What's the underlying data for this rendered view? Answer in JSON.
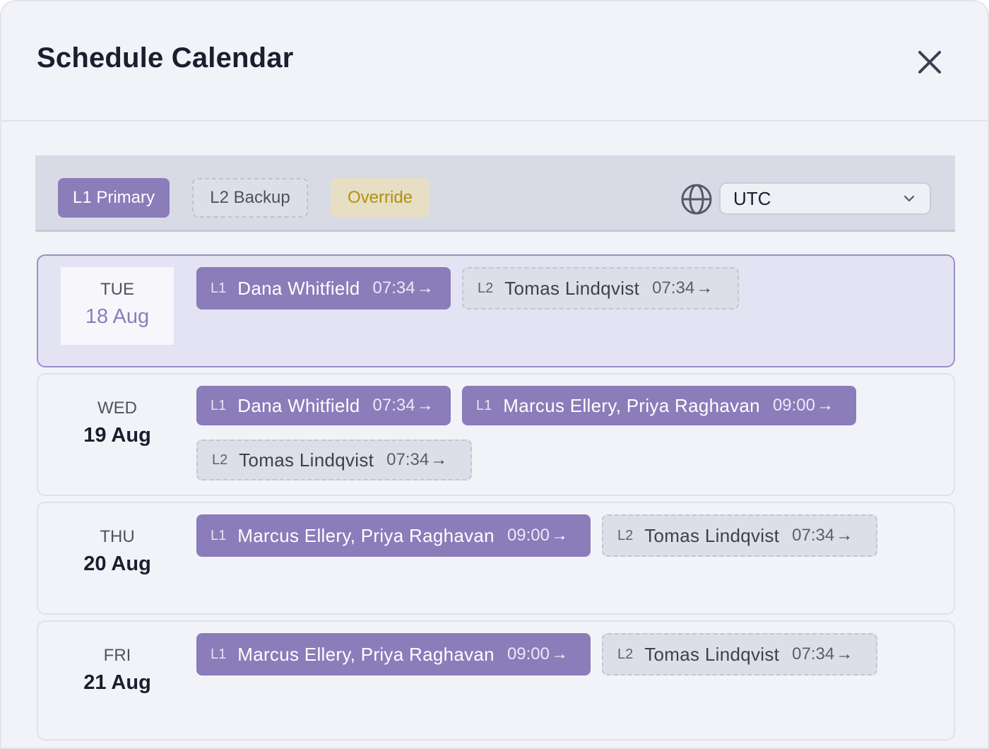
{
  "modal": {
    "title": "Schedule Calendar",
    "close_icon": "close-icon"
  },
  "toolbar": {
    "legend": {
      "primary": "L1 Primary",
      "backup": "L2 Backup",
      "override": "Override"
    },
    "timezone": {
      "icon": "globe-icon",
      "value": "UTC",
      "chevron_icon": "chevron-down-icon"
    }
  },
  "days": [
    {
      "dow": "TUE",
      "date": "18 Aug",
      "selected": true,
      "shifts": [
        {
          "level": "L1",
          "who": "Dana Whitfield",
          "time": "07:34"
        },
        {
          "level": "L2",
          "who": "Tomas Lindqvist",
          "time": "07:34"
        }
      ]
    },
    {
      "dow": "WED",
      "date": "19 Aug",
      "selected": false,
      "shifts": [
        {
          "level": "L1",
          "who": "Dana Whitfield",
          "time": "07:34"
        },
        {
          "level": "L1",
          "who": "Marcus Ellery, Priya Raghavan",
          "time": "09:00"
        },
        {
          "level": "L2",
          "who": "Tomas Lindqvist",
          "time": "07:34"
        }
      ]
    },
    {
      "dow": "THU",
      "date": "20 Aug",
      "selected": false,
      "shifts": [
        {
          "level": "L1",
          "who": "Marcus Ellery, Priya Raghavan",
          "time": "09:00"
        },
        {
          "level": "L2",
          "who": "Tomas Lindqvist",
          "time": "07:34"
        }
      ]
    },
    {
      "dow": "FRI",
      "date": "21 Aug",
      "selected": false,
      "shifts": [
        {
          "level": "L1",
          "who": "Marcus Ellery, Priya Raghavan",
          "time": "09:00"
        },
        {
          "level": "L2",
          "who": "Tomas Lindqvist",
          "time": "07:34"
        }
      ]
    }
  ],
  "arrow_glyph": "→",
  "colors": {
    "primary": "#8b7cba",
    "backup": "#dcdfe7",
    "override_bg": "#e6dfc4",
    "override_text": "#b3900f",
    "selected_row": "#e4e3f3"
  }
}
